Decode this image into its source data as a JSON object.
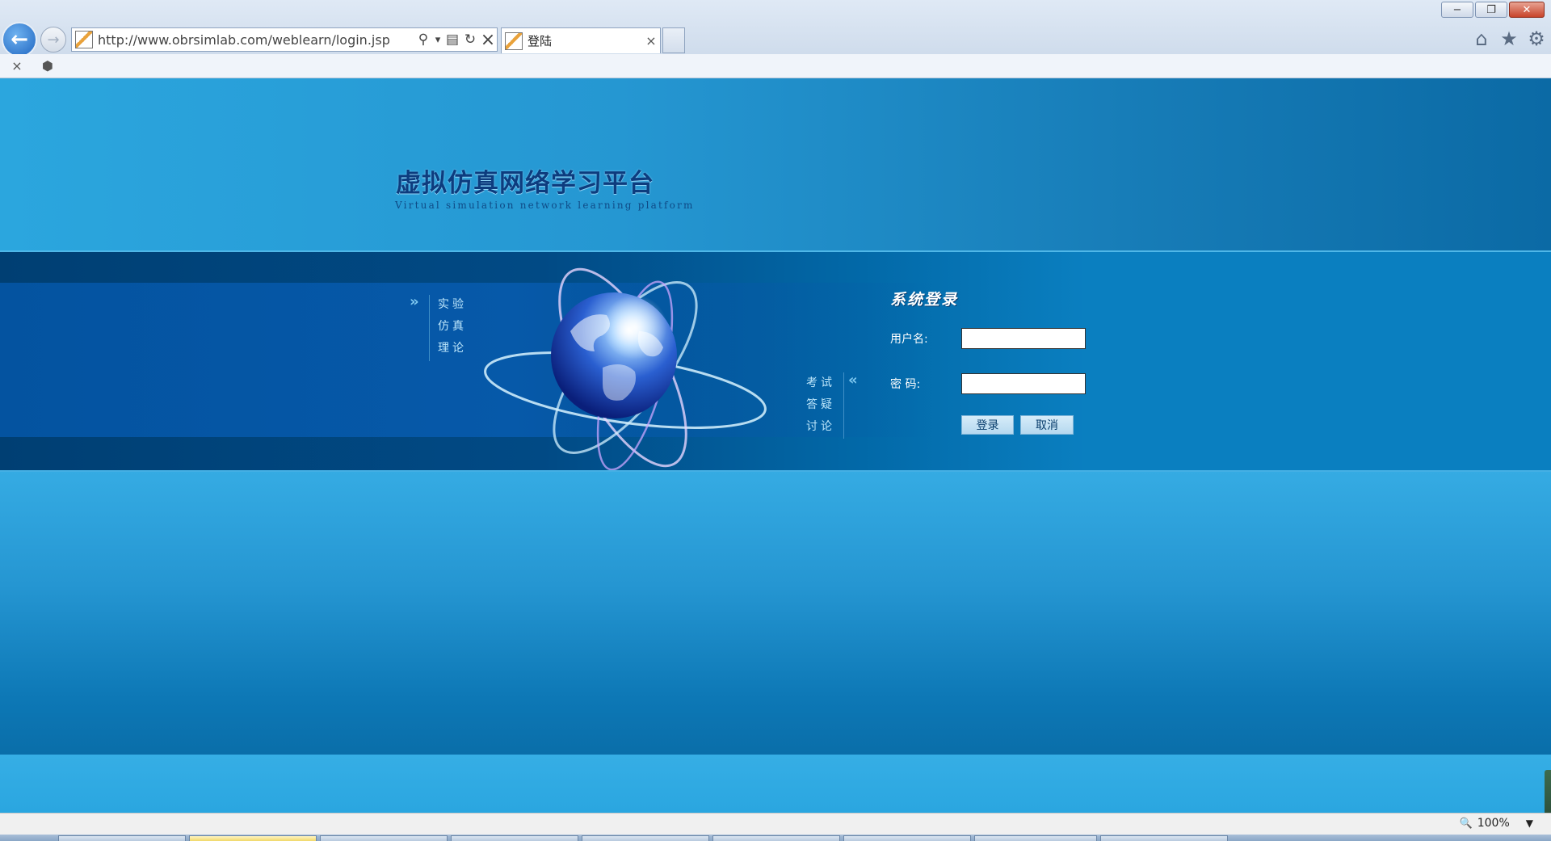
{
  "browser": {
    "url": "http://www.obrsimlab.com/weblearn/login.jsp",
    "tab_title": "登陆",
    "tab_close": "×",
    "back_symbol": "←",
    "forward_symbol": "→",
    "search_symbol": "⚲",
    "dropdown_symbol": "▾",
    "compat_symbol": "▤",
    "refresh_symbol": "↻",
    "stop_symbol": "×",
    "home_symbol": "⌂",
    "favorites_symbol": "★",
    "tools_symbol": "⚙",
    "minimize_symbol": "−",
    "restore_symbol": "❐",
    "close_symbol": "✕",
    "cmd_close_symbol": "×",
    "cmd_addon_symbol": "⬢"
  },
  "site": {
    "title": "虚拟仿真网络学习平台",
    "subtitle": "Virtual simulation network learning platform"
  },
  "nav_left": {
    "arrows": "»",
    "items": [
      "实验",
      "仿真",
      "理论"
    ]
  },
  "nav_right": {
    "arrows": "«",
    "items": [
      "考试",
      "答疑",
      "讨论"
    ]
  },
  "login": {
    "title": "系统登录",
    "username_label": "用户名:",
    "password_label": "密  码:",
    "username_value": "",
    "password_value": "",
    "login_button": "登录",
    "cancel_button": "取消"
  },
  "status": {
    "zoom": "100%",
    "zoom_icon": "🔍",
    "zoom_arrow": "▼"
  },
  "colors": {
    "header_title": "#0d3c7e",
    "band_dark": "#003f73",
    "band_light": "#0a7fc0",
    "nav_text": "#bde6fb",
    "button_text": "#083d6c"
  }
}
